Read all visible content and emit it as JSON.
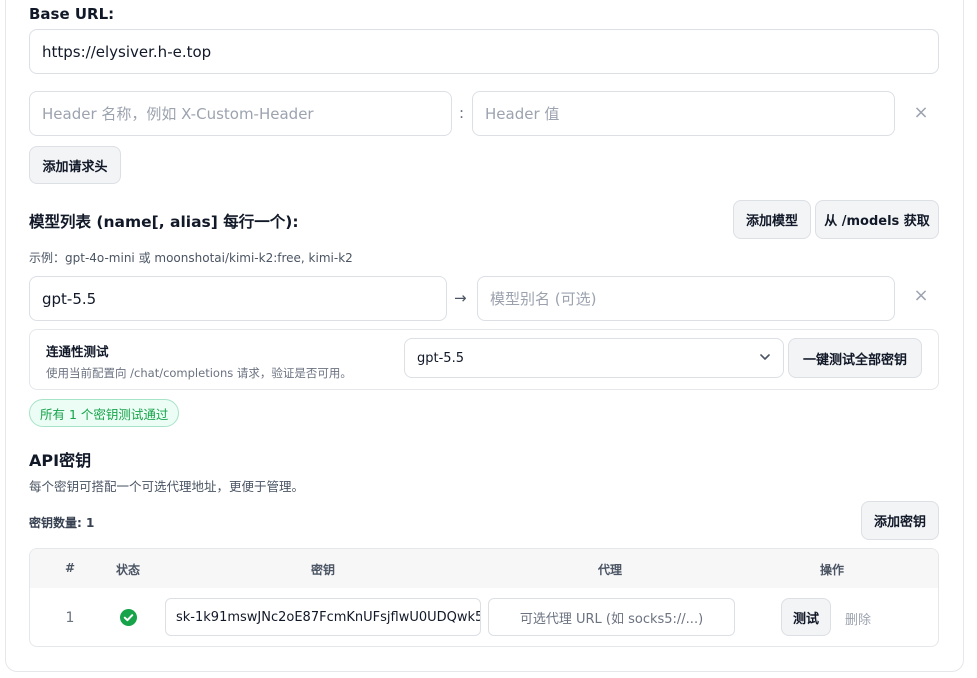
{
  "base_url": {
    "label": "Base URL:",
    "value": "https://elysiver.h-e.top"
  },
  "header_row": {
    "name_placeholder": "Header 名称，例如 X-Custom-Header",
    "separator": ":",
    "value_placeholder": "Header 值",
    "remove_symbol": "×",
    "add_button": "添加请求头"
  },
  "models": {
    "title": "模型列表 (name[, alias] 每行一个):",
    "add_button": "添加模型",
    "fetch_button": "从 /models 获取",
    "example": "示例：gpt-4o-mini 或 moonshotai/kimi-k2:free, kimi-k2",
    "row": {
      "name": "gpt-5.5",
      "arrow": "→",
      "alias_placeholder": "模型别名 (可选)",
      "remove_symbol": "×"
    }
  },
  "connectivity": {
    "title": "连通性测试",
    "description": "使用当前配置向 /chat/completions 请求，验证是否可用。",
    "selected_model": "gpt-5.5",
    "test_all_button": "一键测试全部密钥",
    "result_badge": "所有 1 个密钥测试通过"
  },
  "api_keys": {
    "title": "API密钥",
    "description": "每个密钥可搭配一个可选代理地址，更便于管理。",
    "count_label": "密钥数量: 1",
    "add_button": "添加密钥",
    "columns": [
      "#",
      "状态",
      "密钥",
      "代理",
      "操作"
    ],
    "rows": [
      {
        "index": "1",
        "status": "ok",
        "key": "sk-1k91mswJNc2oE87FcmKnUFsjflwU0UDQwk5",
        "proxy_placeholder": "可选代理 URL (如 socks5://...)",
        "test_button": "测试",
        "delete_button": "删除"
      }
    ]
  },
  "colors": {
    "success": "#16a34a",
    "border": "#dcdfe4",
    "button_bg": "#f3f4f6"
  }
}
